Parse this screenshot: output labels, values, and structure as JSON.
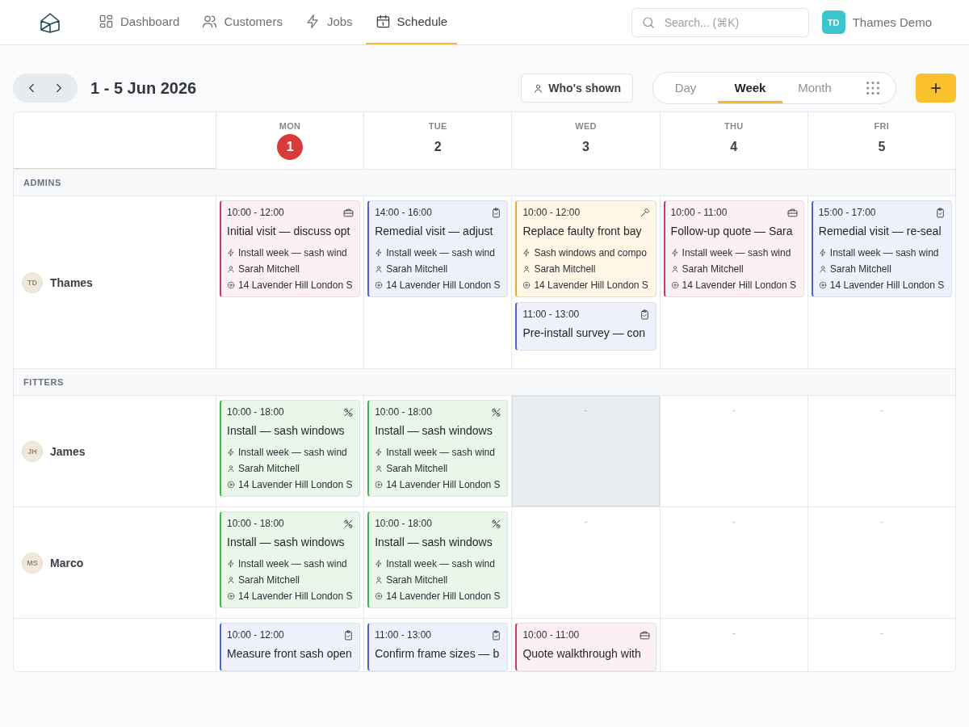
{
  "nav": {
    "items": [
      {
        "label": "Dashboard",
        "kind": "dashboard",
        "selected": false
      },
      {
        "label": "Customers",
        "kind": "users",
        "selected": false
      },
      {
        "label": "Jobs",
        "kind": "bolt",
        "selected": false
      },
      {
        "label": "Schedule",
        "kind": "calendar",
        "selected": true
      }
    ]
  },
  "search": {
    "placeholder": "Search... (⌘K)"
  },
  "account": {
    "initials": "TD",
    "name": "Thames Demo"
  },
  "toolbar": {
    "range": "1 - 5 Jun 2026",
    "whos_shown": "Who's shown",
    "views": [
      {
        "label": "Day",
        "selected": false
      },
      {
        "label": "Week",
        "selected": true
      },
      {
        "label": "Month",
        "selected": false
      }
    ],
    "add_label": "+"
  },
  "days": [
    {
      "dow": "MON",
      "date": "1",
      "today": true
    },
    {
      "dow": "TUE",
      "date": "2",
      "today": false
    },
    {
      "dow": "WED",
      "date": "3",
      "today": false
    },
    {
      "dow": "THU",
      "date": "4",
      "today": false
    },
    {
      "dow": "FRI",
      "date": "5",
      "today": false
    }
  ],
  "groups": [
    {
      "label": "ADMINS",
      "people": [
        {
          "initials": "TD",
          "name": "Thames",
          "cells": [
            {
              "events": [
                {
                  "kind": "quote",
                  "time": "10:00 - 12:00",
                  "title": "Initial visit — discuss opt",
                  "job": "Install week — sash wind",
                  "customer": "Sarah Mitchell",
                  "address": "14 Lavender Hill London S"
                }
              ]
            },
            {
              "events": [
                {
                  "kind": "survey",
                  "time": "14:00 - 16:00",
                  "title": "Remedial visit — adjust",
                  "job": "Install week — sash wind",
                  "customer": "Sarah Mitchell",
                  "address": "14 Lavender Hill London S"
                }
              ]
            },
            {
              "events": [
                {
                  "kind": "repair",
                  "time": "10:00 - 12:00",
                  "title": "Replace faulty front bay",
                  "job": "Sash windows and compo",
                  "customer": "Sarah Mitchell",
                  "address": "14 Lavender Hill London S"
                },
                {
                  "kind": "survey",
                  "time": "11:00 - 13:00",
                  "title": "Pre-install survey — con"
                }
              ]
            },
            {
              "events": [
                {
                  "kind": "quote",
                  "time": "10:00 - 11:00",
                  "title": "Follow-up quote — Sara",
                  "job": "Install week — sash wind",
                  "customer": "Sarah Mitchell",
                  "address": "14 Lavender Hill London S"
                }
              ]
            },
            {
              "events": [
                {
                  "kind": "survey",
                  "time": "15:00 - 17:00",
                  "title": "Remedial visit — re-seal",
                  "job": "Install week — sash wind",
                  "customer": "Sarah Mitchell",
                  "address": "14 Lavender Hill London S"
                }
              ]
            }
          ]
        }
      ]
    },
    {
      "label": "FITTERS",
      "people": [
        {
          "initials": "JH",
          "name": "James",
          "cells": [
            {
              "events": [
                {
                  "kind": "install",
                  "time": "10:00 - 18:00",
                  "title": "Install — sash windows",
                  "job": "Install week — sash wind",
                  "customer": "Sarah Mitchell",
                  "address": "14 Lavender Hill London S"
                }
              ]
            },
            {
              "events": [
                {
                  "kind": "install",
                  "time": "10:00 - 18:00",
                  "title": "Install — sash windows",
                  "job": "Install week — sash wind",
                  "customer": "Sarah Mitchell",
                  "address": "14 Lavender Hill London S"
                }
              ]
            },
            {
              "empty": "-",
              "shaded": true
            },
            {
              "empty": "-",
              "shaded": false
            },
            {
              "empty": "-",
              "shaded": false
            }
          ]
        },
        {
          "initials": "MS",
          "name": "Marco",
          "cells": [
            {
              "events": [
                {
                  "kind": "install",
                  "time": "10:00 - 18:00",
                  "title": "Install — sash windows",
                  "job": "Install week — sash wind",
                  "customer": "Sarah Mitchell",
                  "address": "14 Lavender Hill London S"
                }
              ]
            },
            {
              "events": [
                {
                  "kind": "install",
                  "time": "10:00 - 18:00",
                  "title": "Install — sash windows",
                  "job": "Install week — sash wind",
                  "customer": "Sarah Mitchell",
                  "address": "14 Lavender Hill London S"
                }
              ]
            },
            {
              "empty": "-",
              "shaded": false
            },
            {
              "empty": "-",
              "shaded": false
            },
            {
              "empty": "-",
              "shaded": false
            }
          ]
        },
        {
          "cells": [
            {
              "events": [
                {
                  "kind": "survey",
                  "time": "10:00 - 12:00",
                  "title": "Measure front sash open"
                }
              ]
            },
            {
              "events": [
                {
                  "kind": "survey",
                  "time": "11:00 - 13:00",
                  "title": "Confirm frame sizes — b"
                }
              ]
            },
            {
              "events": [
                {
                  "kind": "quote",
                  "time": "10:00 - 11:00",
                  "title": "Quote walkthrough with"
                }
              ]
            },
            {
              "empty": "-",
              "shaded": false
            },
            {
              "empty": "-",
              "shaded": false
            }
          ]
        }
      ]
    }
  ]
}
